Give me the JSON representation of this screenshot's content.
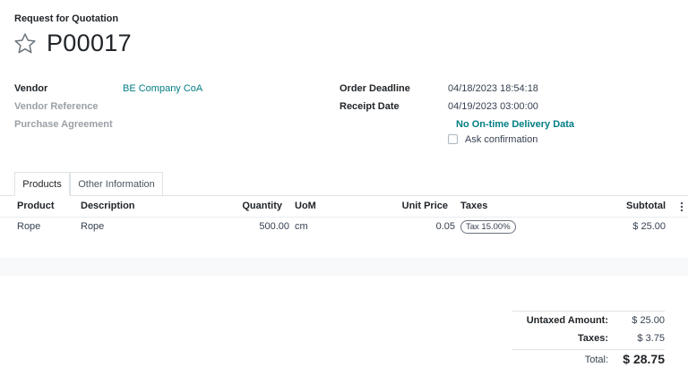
{
  "breadcrumb": "Request for Quotation",
  "order": {
    "name": "P00017"
  },
  "fields_left": {
    "vendor_label": "Vendor",
    "vendor_value": "BE Company CoA",
    "vendor_ref_label": "Vendor Reference",
    "purchase_agreement_label": "Purchase Agreement"
  },
  "fields_right": {
    "order_deadline_label": "Order Deadline",
    "order_deadline_value": "04/18/2023 18:54:18",
    "receipt_date_label": "Receipt Date",
    "receipt_date_value": "04/19/2023 03:00:00",
    "delivery_data": "No On-time Delivery Data",
    "ask_confirmation": "Ask confirmation"
  },
  "tabs": [
    {
      "label": "Products",
      "active": true
    },
    {
      "label": "Other Information",
      "active": false
    }
  ],
  "table": {
    "headers": {
      "product": "Product",
      "description": "Description",
      "quantity": "Quantity",
      "uom": "UoM",
      "unit_price": "Unit Price",
      "taxes": "Taxes",
      "subtotal": "Subtotal"
    },
    "rows": [
      {
        "product": "Rope",
        "description": "Rope",
        "quantity": "500.00",
        "uom": "cm",
        "unit_price": "0.05",
        "tax": "Tax 15.00%",
        "subtotal": "$ 25.00"
      }
    ]
  },
  "totals": {
    "untaxed_label": "Untaxed Amount:",
    "untaxed_value": "$ 25.00",
    "taxes_label": "Taxes:",
    "taxes_value": "$ 3.75",
    "total_label": "Total:",
    "total_value": "$ 28.75"
  },
  "colors": {
    "accent": "#017e84",
    "muted": "#9aa0a6"
  },
  "icons": {
    "favorite": "star-icon",
    "columns": "kebab-icon"
  }
}
